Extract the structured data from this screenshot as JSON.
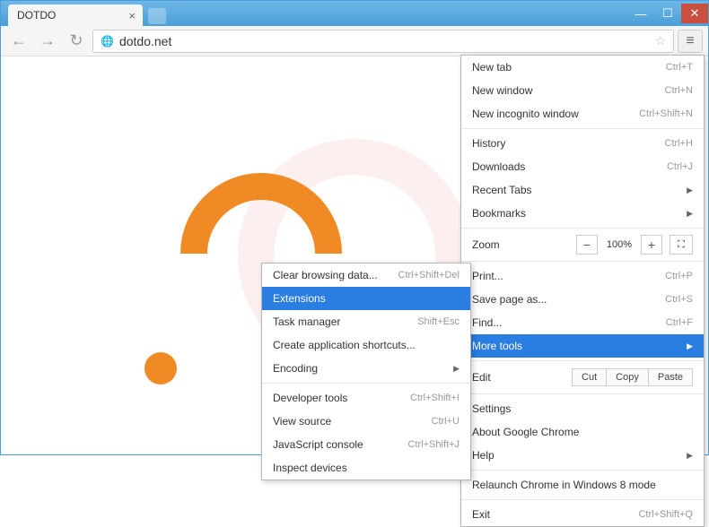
{
  "tab": {
    "title": "DOTDO"
  },
  "url": "dotdo.net",
  "main_menu": {
    "new_tab": "New tab",
    "new_tab_sc": "Ctrl+T",
    "new_window": "New window",
    "new_window_sc": "Ctrl+N",
    "new_incognito": "New incognito window",
    "new_incognito_sc": "Ctrl+Shift+N",
    "history": "History",
    "history_sc": "Ctrl+H",
    "downloads": "Downloads",
    "downloads_sc": "Ctrl+J",
    "recent": "Recent Tabs",
    "bookmarks": "Bookmarks",
    "zoom": "Zoom",
    "zoom_val": "100%",
    "print": "Print...",
    "print_sc": "Ctrl+P",
    "save_as": "Save page as...",
    "save_as_sc": "Ctrl+S",
    "find": "Find...",
    "find_sc": "Ctrl+F",
    "more_tools": "More tools",
    "edit": "Edit",
    "cut": "Cut",
    "copy": "Copy",
    "paste": "Paste",
    "settings": "Settings",
    "about": "About Google Chrome",
    "help": "Help",
    "relaunch": "Relaunch Chrome in Windows 8 mode",
    "exit": "Exit",
    "exit_sc": "Ctrl+Shift+Q"
  },
  "sub_menu": {
    "clear": "Clear browsing data...",
    "clear_sc": "Ctrl+Shift+Del",
    "extensions": "Extensions",
    "task_mgr": "Task manager",
    "task_mgr_sc": "Shift+Esc",
    "shortcuts": "Create application shortcuts...",
    "encoding": "Encoding",
    "dev_tools": "Developer tools",
    "dev_tools_sc": "Ctrl+Shift+I",
    "view_src": "View source",
    "view_src_sc": "Ctrl+U",
    "js_console": "JavaScript console",
    "js_console_sc": "Ctrl+Shift+J",
    "inspect": "Inspect devices"
  }
}
